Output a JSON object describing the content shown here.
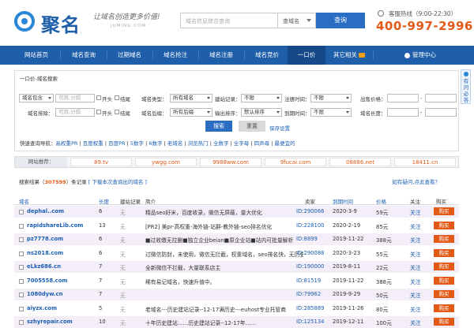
{
  "header": {
    "logo_text": "聚名",
    "slogan": "让域名创造更多价值!",
    "slogan_sub": "JUMING.COM",
    "search_placeholder": "域名信息综合查询",
    "search_type": "查域名",
    "search_button": "查询",
    "hotline_label": "客服热线（9:00-22:30）",
    "hotline_number": "400-997-2996"
  },
  "nav": {
    "items": [
      "网站首页",
      "域名查询",
      "过期域名",
      "域名抢注",
      "域名注册",
      "域名竞价",
      "一口价",
      "其它相关",
      "管理中心"
    ],
    "active": "一口价"
  },
  "panel": {
    "title": "一口价-域名搜索",
    "row1": {
      "include_select": "域名包含",
      "input_placeholder": "可用,分隔",
      "cb1": "开头",
      "cb2": "结尾",
      "type_label": "域名类型：",
      "type_value": "所有域名",
      "record_label": "建站记录：",
      "record_value": "不限",
      "regtime_label": "注册时间：",
      "regtime_value": "不限",
      "price_label": "出售价格：",
      "price_sep": "-"
    },
    "row2": {
      "exclude_label": "域名排除：",
      "input_placeholder": "可用,分隔",
      "cb1": "开头",
      "cb2": "结尾",
      "suffix_label": "域名后缀：",
      "suffix_value": "所有后缀",
      "sort_label": "输出排序：",
      "sort_value": "默认排序",
      "expire_label": "到期时间：",
      "expire_value": "不限",
      "length_label": "域名长度：",
      "length_sep": "-"
    },
    "search_button": "搜索",
    "reset_button": "重置",
    "save_link": "保存设置",
    "quick_label": "快速查询导航：",
    "quick_links": [
      "高权重PR",
      "百度权重",
      "百度PR",
      "5数字",
      "6数字",
      "老域名",
      "浏览热门",
      "全数字",
      "全字母",
      "四声母",
      "最便宜的"
    ]
  },
  "recommend": {
    "label": "网站推荐：",
    "items": [
      "89.tv",
      "ywgg.com",
      "9988ww.com",
      "9fucai.com",
      "08886.net",
      "18411.cn"
    ]
  },
  "results": {
    "title_prefix": "搜索结果（",
    "count": "307599",
    "title_suffix": "）条记录",
    "download_link": "[ 下载本次查询出的域名 ]",
    "help_link": "如有疑问,点此查看？",
    "headers": [
      "域名",
      "长度",
      "建站记录",
      "简介",
      "卖家",
      "到期时间",
      "价格",
      "关注",
      "购买"
    ],
    "rows": [
      {
        "domain": "dephal..com",
        "length": "6",
        "record": "无",
        "desc": "精品seo好米，百度收录，微信无屏蔽，量大优化",
        "seller": "ID:290066",
        "date": "2020-3-9",
        "price": "59元",
        "follow": "关注",
        "buy": "购买"
      },
      {
        "domain": "rapidshareLib.com",
        "length": "13",
        "record": "无",
        "desc": "[PR2] 美pr-高权重-海外链-站群-教外链-seo排名优化",
        "seller": "ID:228100",
        "date": "2020-2-19",
        "price": "85元",
        "follow": "关注",
        "buy": "购买"
      },
      {
        "domain": "pz7778.com",
        "length": "6",
        "record": "无",
        "desc": "■过收缴无拉删■独立企业beian■原企业站■站内可批量解析",
        "seller": "ID:8899",
        "date": "2019-11-22",
        "price": "388元",
        "follow": "关注",
        "buy": "购买"
      },
      {
        "domain": "ns2018.com",
        "length": "6",
        "record": "无",
        "desc": "过微信防封，未使用，微信无拦截，权重域名，seo排名快，无历史",
        "seller": "ID:290088",
        "date": "2020-3-23",
        "price": "55元",
        "follow": "关注",
        "buy": "购买"
      },
      {
        "domain": "eLkz686.cn",
        "length": "7",
        "record": "无",
        "desc": "全新微信不拦截，大量联系店主",
        "seller": "ID:190000",
        "date": "2019-8-11",
        "price": "22元",
        "follow": "关注",
        "buy": "购买"
      },
      {
        "domain": "7005558.com",
        "length": "7",
        "record": "无",
        "desc": "稀有易记域名，快速升值中。",
        "seller": "ID:81519",
        "date": "2019-11-22",
        "price": "388元",
        "follow": "关注",
        "buy": "购买"
      },
      {
        "domain": "1080dyw.cn",
        "length": "7",
        "record": "无",
        "desc": "",
        "seller": "ID:79962",
        "date": "2019-9-29",
        "price": "50元",
        "follow": "关注",
        "buy": "购买"
      },
      {
        "domain": "aiyzx.com",
        "length": "5",
        "record": "无",
        "desc": "老域名---历史建站记录--12-17满历史---euhost专业托管商",
        "seller": "ID:285889",
        "date": "2019-11-26",
        "price": "80元",
        "follow": "关注",
        "buy": "购买"
      },
      {
        "domain": "szhyrepair.com",
        "length": "10",
        "record": "无",
        "desc": "十年历史建站……历史建站记录--12-17年……",
        "seller": "ID:125134",
        "date": "2019-12-11",
        "price": "100元",
        "follow": "关注",
        "buy": "购买"
      }
    ]
  },
  "sidetab": {
    "text": "有问必答"
  }
}
